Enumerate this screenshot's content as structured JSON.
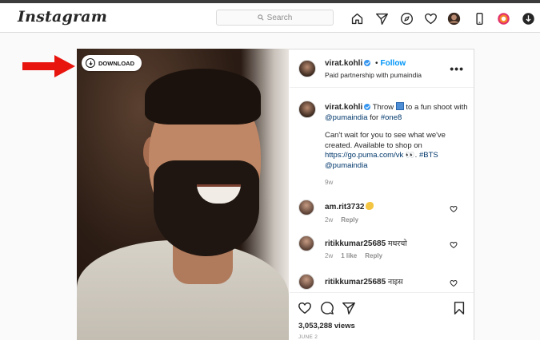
{
  "nav": {
    "logo": "Instagram",
    "search_placeholder": "Search",
    "icons": [
      "home-icon",
      "direct-icon",
      "explore-icon",
      "activity-heart-icon",
      "profile-avatar",
      "phone-icon",
      "extension-icon",
      "download-extension-icon"
    ]
  },
  "overlay": {
    "download_label": "DOWNLOAD"
  },
  "post": {
    "username": "virat.kohli",
    "follow_label": "Follow",
    "dot": "•",
    "subtitle": "Paid partnership with pumaindia",
    "more": "•••",
    "caption": {
      "username": "virat.kohli",
      "text_1": " Throw",
      "text_2": " to a fun shoot with ",
      "mention_1": "@pumaindia",
      "text_3": " for ",
      "hashtag_1": "#one8",
      "para_2": "Can't wait for you to see what we've created. Available to shop on ",
      "link": "https://go.puma.com/vk",
      "text_4": " 👀. ",
      "hashtag_2": "#BTS",
      "mention_2": "@pumaindia",
      "time": "9w"
    },
    "comments": [
      {
        "username": "am.rit3732",
        "text": "",
        "time": "2w",
        "likes": "",
        "reply": "Reply"
      },
      {
        "username": "ritikkumar25685",
        "text": "मधरचो",
        "time": "2w",
        "likes": "1 like",
        "reply": "Reply"
      },
      {
        "username": "ritikkumar25685",
        "text": "नाइस",
        "time": "",
        "likes": "",
        "reply": ""
      }
    ],
    "views": "3,053,288 views",
    "date": "JUNE 2"
  },
  "colors": {
    "link": "#00376b",
    "follow": "#0095f6",
    "arrow": "#e8150f",
    "border": "#dbdbdb"
  }
}
